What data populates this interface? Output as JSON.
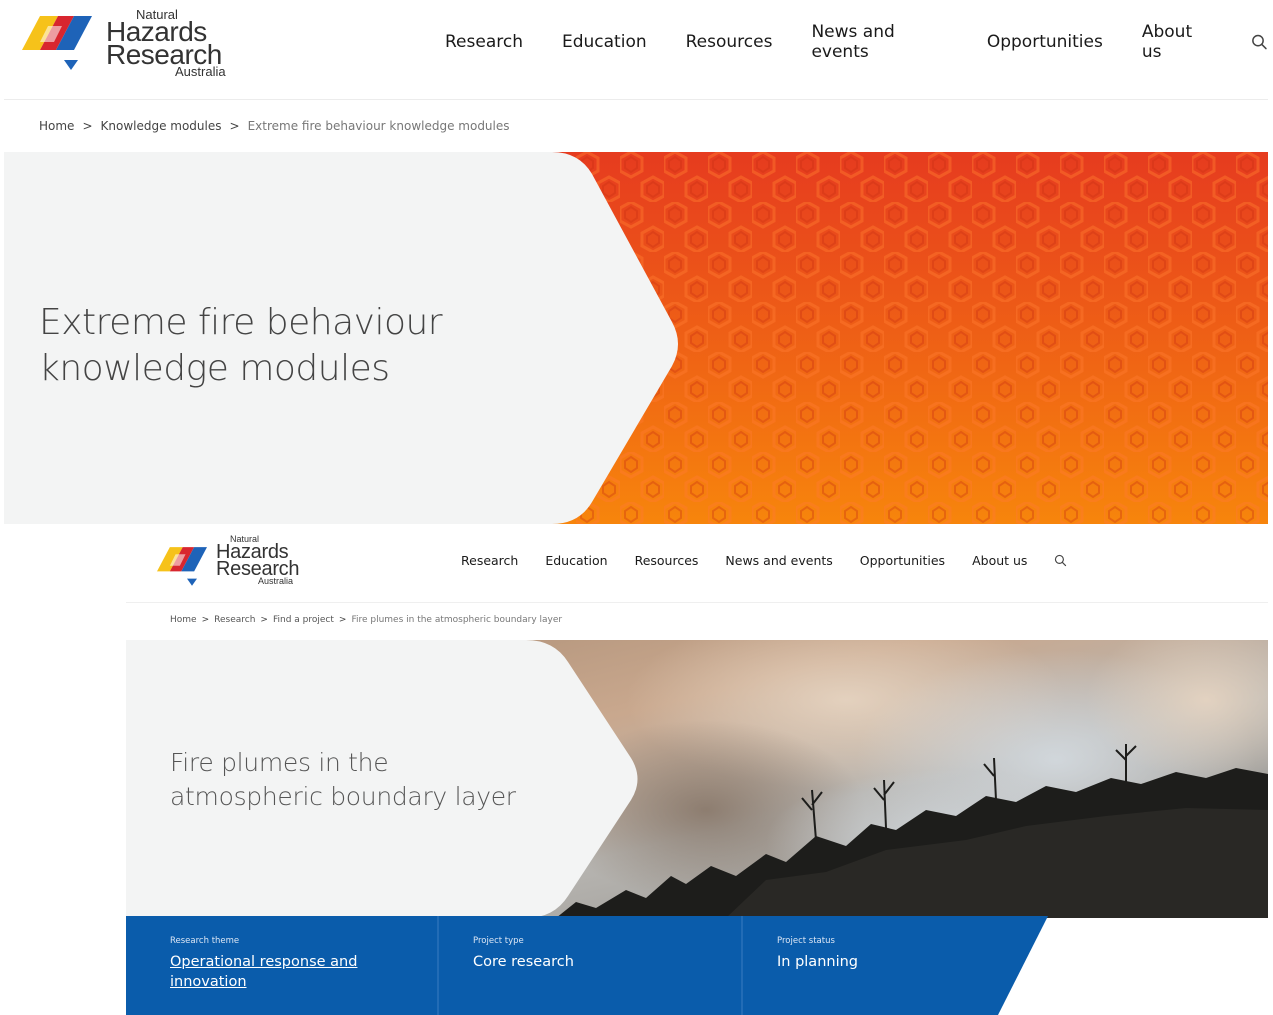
{
  "colors": {
    "primary_blue": "#0a5cab",
    "hero_orange_top": "#e63b1f",
    "hero_orange_bottom": "#f7850c",
    "hero_panel": "#f3f4f4"
  },
  "page1": {
    "logo": {
      "natural": "Natural",
      "hazards": "Hazards",
      "research": "Research",
      "australia": "Australia"
    },
    "nav": {
      "items": [
        "Research",
        "Education",
        "Resources",
        "News and events",
        "Opportunities",
        "About us"
      ],
      "search_icon": "search-icon"
    },
    "breadcrumb": {
      "home": "Home",
      "section": "Knowledge modules",
      "current": "Extreme fire behaviour knowledge modules",
      "separator": ">"
    },
    "hero": {
      "title_line1": "Extreme fire behaviour",
      "title_line2": "knowledge modules"
    }
  },
  "page2": {
    "logo": {
      "natural": "Natural",
      "hazards": "Hazards",
      "research": "Research",
      "australia": "Australia"
    },
    "nav": {
      "items": [
        "Research",
        "Education",
        "Resources",
        "News and events",
        "Opportunities",
        "About us"
      ],
      "search_icon": "search-icon"
    },
    "breadcrumb": {
      "home": "Home",
      "level1": "Research",
      "level2": "Find a project",
      "current": "Fire plumes in the atmospheric boundary layer",
      "separator": ">"
    },
    "hero": {
      "title_line1": "Fire plumes in the",
      "title_line2": "atmospheric boundary layer"
    },
    "meta": {
      "theme_label": "Research theme",
      "theme_value_line1": "Operational response and",
      "theme_value_line2": "innovation",
      "type_label": "Project type",
      "type_value": "Core research",
      "status_label": "Project status",
      "status_value": "In planning"
    }
  }
}
